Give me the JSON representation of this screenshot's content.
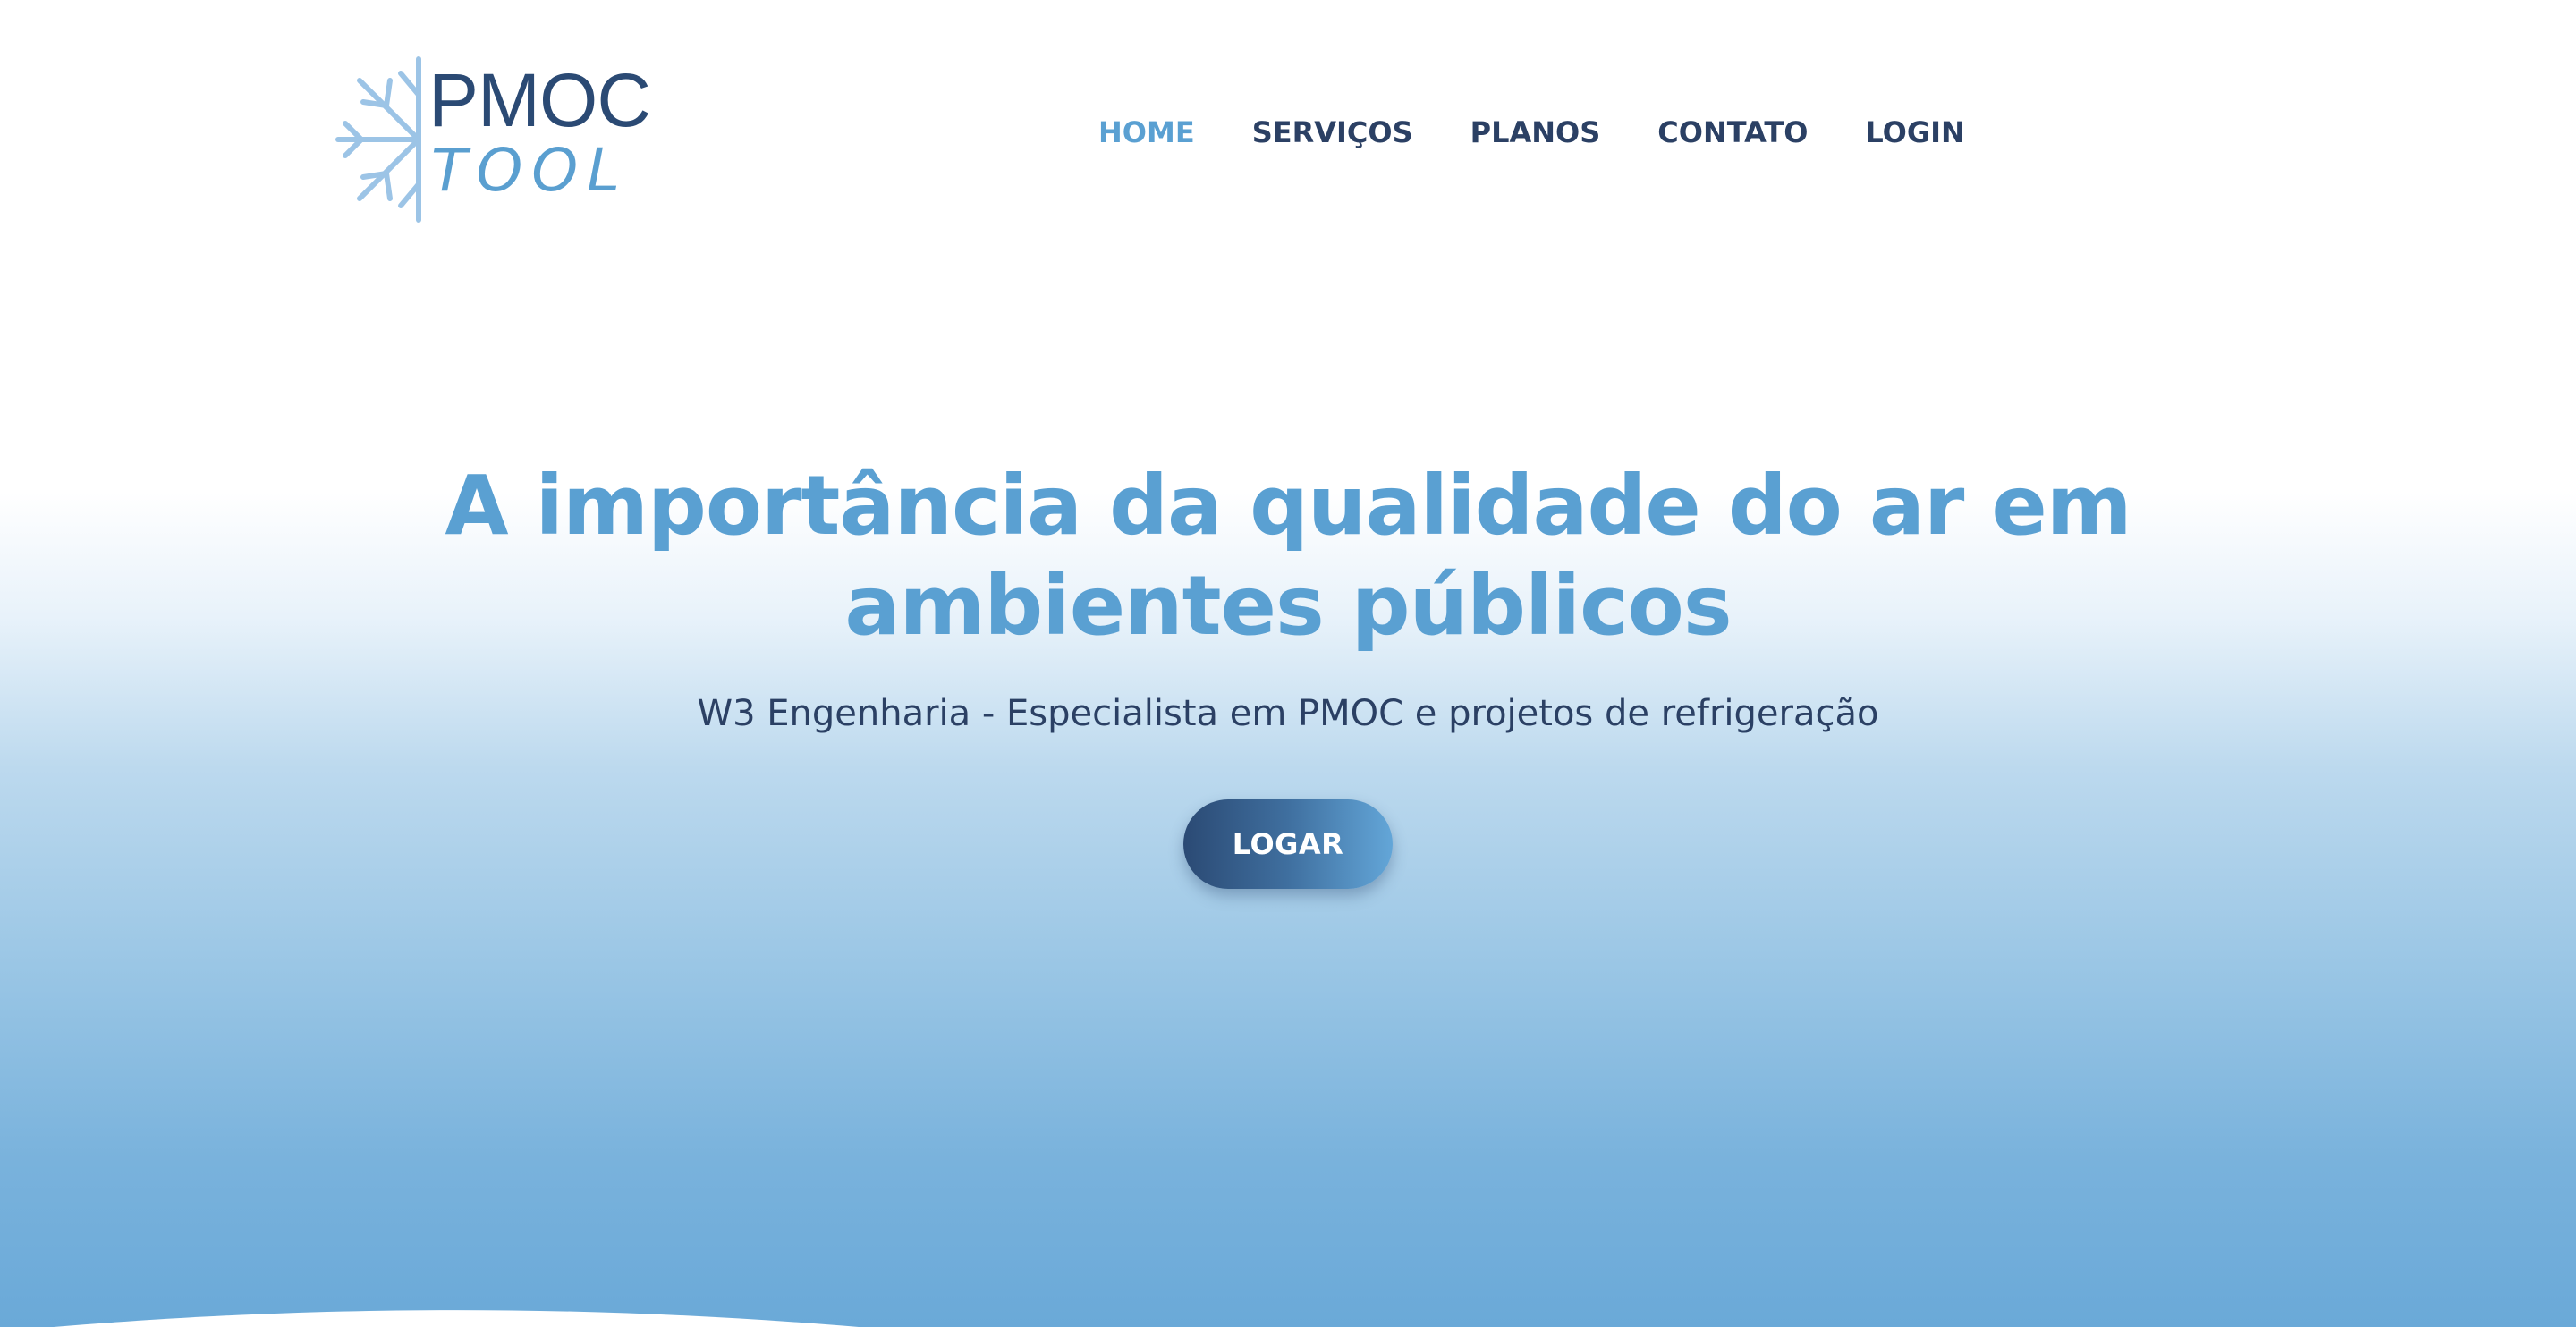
{
  "brand": {
    "name_top": "PMOC",
    "name_bottom": "TOOL",
    "icon": "snowflake-icon",
    "colors": {
      "dark": "#2b4a74",
      "light": "#5a9fd0"
    }
  },
  "nav": {
    "items": [
      {
        "label": "HOME",
        "active": true
      },
      {
        "label": "SERVIÇOS",
        "active": false
      },
      {
        "label": "PLANOS",
        "active": false
      },
      {
        "label": "CONTATO",
        "active": false
      },
      {
        "label": "LOGIN",
        "active": false
      }
    ]
  },
  "hero": {
    "title_line1": "A importância da qualidade do ar em",
    "title_line2": "ambientes públicos",
    "subtitle": "W3 Engenharia - Especialista em PMOC e projetos de refrigeração",
    "cta_label": "LOGAR"
  },
  "theme": {
    "accent": "#5aa0d2",
    "text_dark": "#2b4064",
    "gradient_bottom": "#6aa9d8"
  }
}
